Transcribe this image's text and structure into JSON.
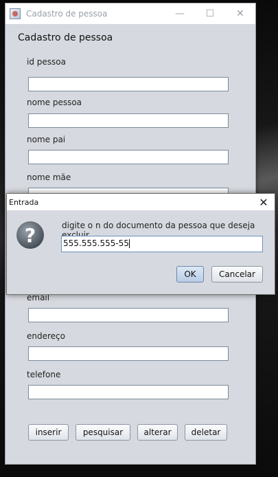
{
  "window": {
    "title": "Cadastro de pessoa",
    "controls": {
      "minimize": "—",
      "maximize": "☐",
      "close": "✕"
    }
  },
  "form": {
    "heading": "Cadastro de pessoa",
    "fields": {
      "id": {
        "label": "id pessoa",
        "value": ""
      },
      "nome": {
        "label": "nome pessoa",
        "value": ""
      },
      "pai": {
        "label": "nome pai",
        "value": ""
      },
      "mae": {
        "label": "nome mãe",
        "value": ""
      },
      "email": {
        "label": "email",
        "value": ""
      },
      "endereco": {
        "label": "endereço",
        "value": ""
      },
      "telefone": {
        "label": "telefone",
        "value": ""
      }
    },
    "buttons": {
      "inserir": "inserir",
      "pesquisar": "pesquisar",
      "alterar": "alterar",
      "deletar": "deletar"
    }
  },
  "dialog": {
    "title": "Entrada",
    "close_glyph": "✕",
    "icon": "question-icon",
    "icon_glyph": "?",
    "message": "digite o n do documento da pessoa que deseja excluir",
    "input_value": "555.555.555-55",
    "ok_label": "OK",
    "cancel_label": "Cancelar"
  }
}
